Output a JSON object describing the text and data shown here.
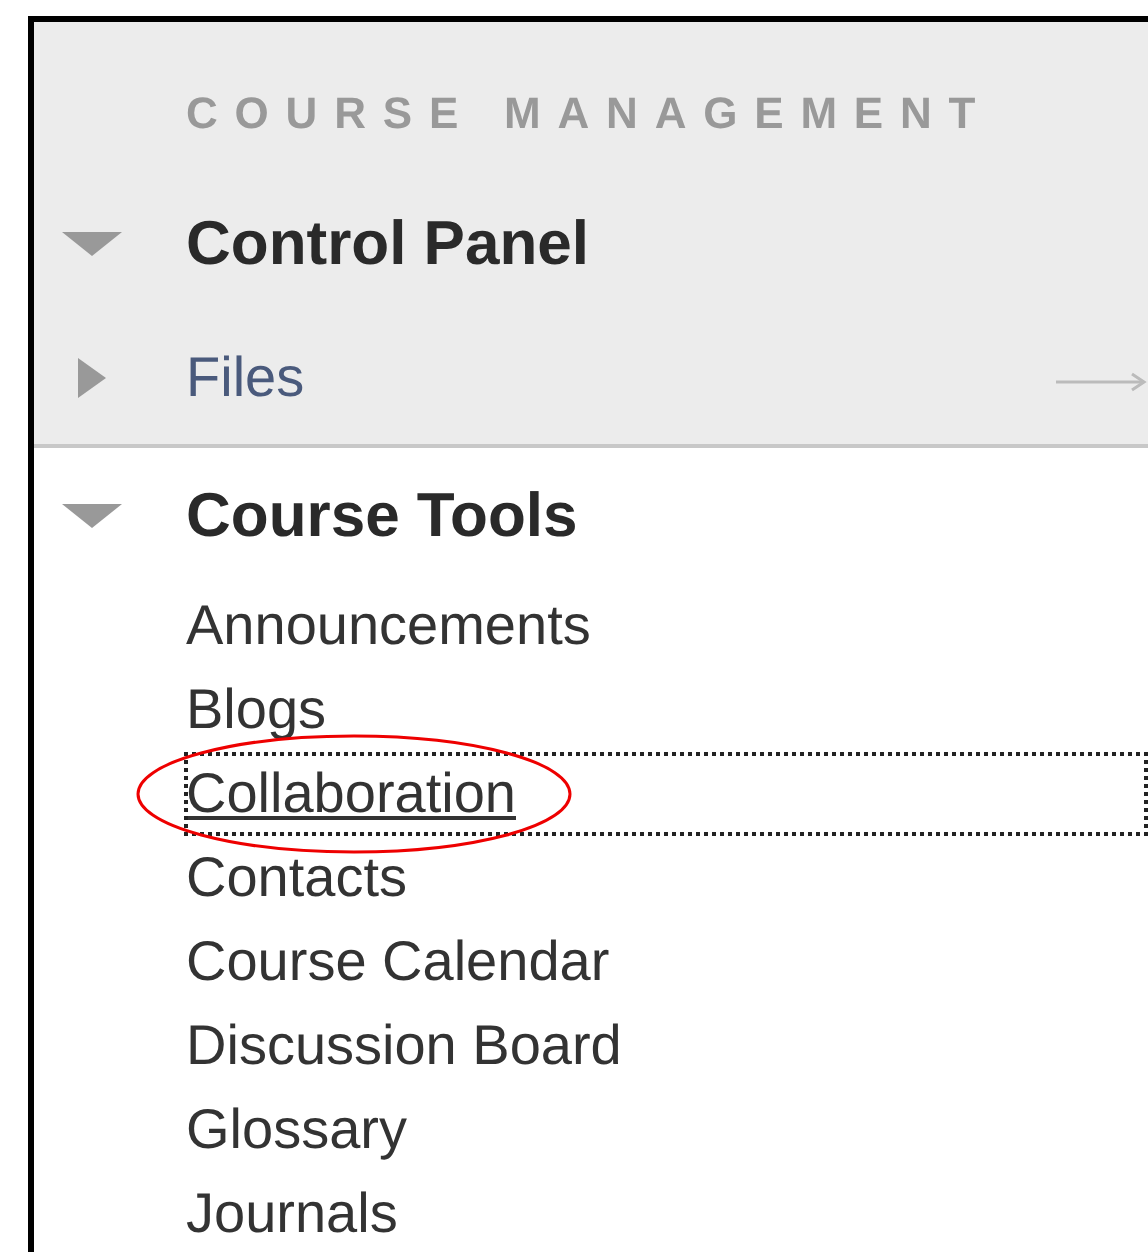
{
  "section_title": "COURSE MANAGEMENT",
  "panels": [
    {
      "label": "Control Panel",
      "expanded": true,
      "kind": "heading",
      "grey": true
    },
    {
      "label": "Files",
      "expanded": false,
      "kind": "link",
      "grey": true
    },
    {
      "label": "Course Tools",
      "expanded": true,
      "kind": "heading",
      "grey": false
    }
  ],
  "course_tools": [
    {
      "label": "Announcements",
      "focused": false
    },
    {
      "label": "Blogs",
      "focused": false
    },
    {
      "label": "Collaboration",
      "focused": true
    },
    {
      "label": "Contacts",
      "focused": false
    },
    {
      "label": "Course Calendar",
      "focused": false
    },
    {
      "label": "Discussion Board",
      "focused": false
    },
    {
      "label": "Glossary",
      "focused": false
    },
    {
      "label": "Journals",
      "focused": false
    }
  ]
}
